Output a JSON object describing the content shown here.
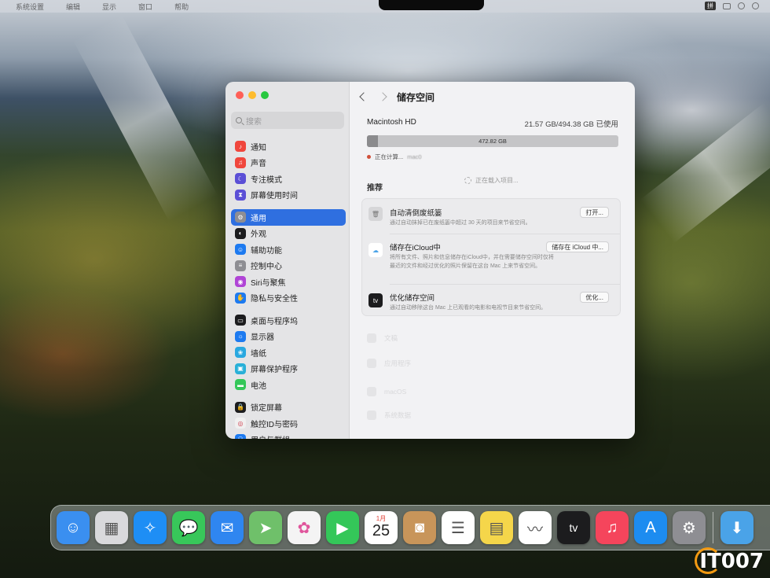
{
  "menubar": {
    "items": [
      "系统设置",
      "编辑",
      "显示",
      "窗口",
      "帮助"
    ],
    "ime": "拼"
  },
  "window": {
    "search_placeholder": "搜索",
    "title": "储存空间",
    "sidebar": [
      {
        "label": "通知",
        "icon": "bell-icon",
        "color": "#f0463c",
        "glyph": "♪"
      },
      {
        "label": "声音",
        "icon": "speaker-icon",
        "color": "#f0463c",
        "glyph": "♫"
      },
      {
        "label": "专注模式",
        "icon": "moon-icon",
        "color": "#5b4fd6",
        "glyph": "☾"
      },
      {
        "label": "屏幕使用时间",
        "icon": "hourglass-icon",
        "color": "#5b4fd6",
        "glyph": "⧗"
      },
      {
        "label": "通用",
        "icon": "gear-icon",
        "color": "#8e8e93",
        "glyph": "⚙",
        "selected": true
      },
      {
        "label": "外观",
        "icon": "appearance-icon",
        "color": "#1c1c1e",
        "glyph": "◐"
      },
      {
        "label": "辅助功能",
        "icon": "accessibility-icon",
        "color": "#1d7af0",
        "glyph": "☺"
      },
      {
        "label": "控制中心",
        "icon": "control-center-icon",
        "color": "#8e8e93",
        "glyph": "≡"
      },
      {
        "label": "Siri与聚焦",
        "icon": "siri-icon",
        "color": "#b044d6",
        "glyph": "◉"
      },
      {
        "label": "隐私与安全性",
        "icon": "hand-icon",
        "color": "#1d7af0",
        "glyph": "✋"
      },
      {
        "label": "桌面与程序坞",
        "icon": "dock-icon",
        "color": "#1c1c1e",
        "glyph": "▭"
      },
      {
        "label": "显示器",
        "icon": "display-icon",
        "color": "#1d7af0",
        "glyph": "☼"
      },
      {
        "label": "墙纸",
        "icon": "wallpaper-icon",
        "color": "#29a8e0",
        "glyph": "❀"
      },
      {
        "label": "屏幕保护程序",
        "icon": "screensaver-icon",
        "color": "#29b0d8",
        "glyph": "▣"
      },
      {
        "label": "电池",
        "icon": "battery-icon",
        "color": "#34c759",
        "glyph": "▬"
      },
      {
        "label": "锁定屏幕",
        "icon": "lock-icon",
        "color": "#1c1c1e",
        "glyph": "🔒"
      },
      {
        "label": "触控ID与密码",
        "icon": "fingerprint-icon",
        "color": "#f0f0f0",
        "glyph": "◎"
      },
      {
        "label": "用户与群组",
        "icon": "users-icon",
        "color": "#1d7af0",
        "glyph": "⚇"
      }
    ],
    "disk": {
      "name": "Macintosh HD",
      "usage": "21.57 GB/494.38 GB 已使用",
      "used_fraction": 0.0436,
      "available": "472.82 GB",
      "legend_status": "正在计算...",
      "legend_name": "mac0"
    },
    "recommend": {
      "heading": "推荐",
      "loading": "正在载入项目...",
      "items": [
        {
          "title": "自动清倒废纸篓",
          "desc": "通过自动抹掉已在废纸篓中超过 30 天的项目来节省空间。",
          "button": "打开...",
          "icon": "trash-icon"
        },
        {
          "title": "储存在iCloud中",
          "desc": "将所有文件、照片和信息储存在iCloud中，并在需要储存空间时仅将最近的文件和经过优化的照片保留在这台 Mac 上来节省空间。",
          "button": "储存在 iCloud 中...",
          "icon": "icloud-icon"
        },
        {
          "title": "优化储存空间",
          "desc": "通过自动移除这台 Mac 上已观看的电影和电视节目来节省空间。",
          "button": "优化...",
          "icon": "appletv-icon"
        }
      ]
    },
    "categories": [
      "文稿",
      "应用程序",
      "macOS",
      "系统数据"
    ]
  },
  "dock": [
    {
      "name": "finder",
      "icon": "finder-icon",
      "color": "#3a8ff0",
      "glyph": "☺"
    },
    {
      "name": "launchpad",
      "icon": "launchpad-icon",
      "color": "#d9d9dc",
      "glyph": "▦"
    },
    {
      "name": "safari",
      "icon": "safari-icon",
      "color": "#1e8ef5",
      "glyph": "✧"
    },
    {
      "name": "messages",
      "icon": "messages-icon",
      "color": "#38c75a",
      "glyph": "💬"
    },
    {
      "name": "mail",
      "icon": "mail-icon",
      "color": "#2f86f0",
      "glyph": "✉"
    },
    {
      "name": "maps",
      "icon": "maps-icon",
      "color": "#6fc06a",
      "glyph": "➤"
    },
    {
      "name": "photos",
      "icon": "photos-icon",
      "color": "#f4f4f4",
      "glyph": "✿"
    },
    {
      "name": "facetime",
      "icon": "facetime-icon",
      "color": "#34c759",
      "glyph": "▶"
    },
    {
      "name": "calendar",
      "icon": "calendar-icon",
      "color": "#ffffff",
      "month": "1月",
      "day": "25"
    },
    {
      "name": "contacts",
      "icon": "contacts-icon",
      "color": "#c8955a",
      "glyph": "◙"
    },
    {
      "name": "reminders",
      "icon": "reminders-icon",
      "color": "#ffffff",
      "glyph": "☰"
    },
    {
      "name": "notes",
      "icon": "notes-icon",
      "color": "#f5d64a",
      "glyph": "▤"
    },
    {
      "name": "freeform",
      "icon": "freeform-icon",
      "color": "#ffffff",
      "glyph": "〰"
    },
    {
      "name": "tv",
      "icon": "appletv-icon",
      "color": "#1c1c1e",
      "glyph": "tv"
    },
    {
      "name": "music",
      "icon": "music-icon",
      "color": "#f5455c",
      "glyph": "♫"
    },
    {
      "name": "app-store",
      "icon": "appstore-icon",
      "color": "#1d8cf0",
      "glyph": "A"
    },
    {
      "name": "system-settings",
      "icon": "settings-icon",
      "color": "#8e8e93",
      "glyph": "⚙"
    },
    {
      "name": "downloads",
      "icon": "downloads-icon",
      "color": "#4aa3e8",
      "glyph": "⬇"
    }
  ],
  "watermark": "IT007"
}
